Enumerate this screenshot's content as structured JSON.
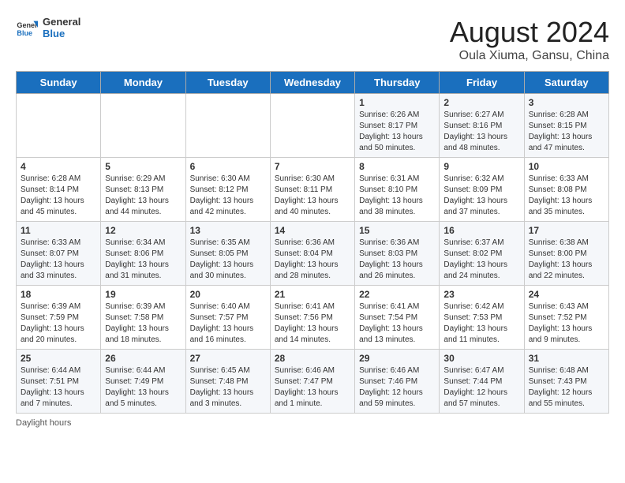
{
  "header": {
    "logo_line1": "General",
    "logo_line2": "Blue",
    "title": "August 2024",
    "subtitle": "Oula Xiuma, Gansu, China"
  },
  "weekdays": [
    "Sunday",
    "Monday",
    "Tuesday",
    "Wednesday",
    "Thursday",
    "Friday",
    "Saturday"
  ],
  "weeks": [
    [
      {
        "day": "",
        "info": ""
      },
      {
        "day": "",
        "info": ""
      },
      {
        "day": "",
        "info": ""
      },
      {
        "day": "",
        "info": ""
      },
      {
        "day": "1",
        "info": "Sunrise: 6:26 AM\nSunset: 8:17 PM\nDaylight: 13 hours\nand 50 minutes."
      },
      {
        "day": "2",
        "info": "Sunrise: 6:27 AM\nSunset: 8:16 PM\nDaylight: 13 hours\nand 48 minutes."
      },
      {
        "day": "3",
        "info": "Sunrise: 6:28 AM\nSunset: 8:15 PM\nDaylight: 13 hours\nand 47 minutes."
      }
    ],
    [
      {
        "day": "4",
        "info": "Sunrise: 6:28 AM\nSunset: 8:14 PM\nDaylight: 13 hours\nand 45 minutes."
      },
      {
        "day": "5",
        "info": "Sunrise: 6:29 AM\nSunset: 8:13 PM\nDaylight: 13 hours\nand 44 minutes."
      },
      {
        "day": "6",
        "info": "Sunrise: 6:30 AM\nSunset: 8:12 PM\nDaylight: 13 hours\nand 42 minutes."
      },
      {
        "day": "7",
        "info": "Sunrise: 6:30 AM\nSunset: 8:11 PM\nDaylight: 13 hours\nand 40 minutes."
      },
      {
        "day": "8",
        "info": "Sunrise: 6:31 AM\nSunset: 8:10 PM\nDaylight: 13 hours\nand 38 minutes."
      },
      {
        "day": "9",
        "info": "Sunrise: 6:32 AM\nSunset: 8:09 PM\nDaylight: 13 hours\nand 37 minutes."
      },
      {
        "day": "10",
        "info": "Sunrise: 6:33 AM\nSunset: 8:08 PM\nDaylight: 13 hours\nand 35 minutes."
      }
    ],
    [
      {
        "day": "11",
        "info": "Sunrise: 6:33 AM\nSunset: 8:07 PM\nDaylight: 13 hours\nand 33 minutes."
      },
      {
        "day": "12",
        "info": "Sunrise: 6:34 AM\nSunset: 8:06 PM\nDaylight: 13 hours\nand 31 minutes."
      },
      {
        "day": "13",
        "info": "Sunrise: 6:35 AM\nSunset: 8:05 PM\nDaylight: 13 hours\nand 30 minutes."
      },
      {
        "day": "14",
        "info": "Sunrise: 6:36 AM\nSunset: 8:04 PM\nDaylight: 13 hours\nand 28 minutes."
      },
      {
        "day": "15",
        "info": "Sunrise: 6:36 AM\nSunset: 8:03 PM\nDaylight: 13 hours\nand 26 minutes."
      },
      {
        "day": "16",
        "info": "Sunrise: 6:37 AM\nSunset: 8:02 PM\nDaylight: 13 hours\nand 24 minutes."
      },
      {
        "day": "17",
        "info": "Sunrise: 6:38 AM\nSunset: 8:00 PM\nDaylight: 13 hours\nand 22 minutes."
      }
    ],
    [
      {
        "day": "18",
        "info": "Sunrise: 6:39 AM\nSunset: 7:59 PM\nDaylight: 13 hours\nand 20 minutes."
      },
      {
        "day": "19",
        "info": "Sunrise: 6:39 AM\nSunset: 7:58 PM\nDaylight: 13 hours\nand 18 minutes."
      },
      {
        "day": "20",
        "info": "Sunrise: 6:40 AM\nSunset: 7:57 PM\nDaylight: 13 hours\nand 16 minutes."
      },
      {
        "day": "21",
        "info": "Sunrise: 6:41 AM\nSunset: 7:56 PM\nDaylight: 13 hours\nand 14 minutes."
      },
      {
        "day": "22",
        "info": "Sunrise: 6:41 AM\nSunset: 7:54 PM\nDaylight: 13 hours\nand 13 minutes."
      },
      {
        "day": "23",
        "info": "Sunrise: 6:42 AM\nSunset: 7:53 PM\nDaylight: 13 hours\nand 11 minutes."
      },
      {
        "day": "24",
        "info": "Sunrise: 6:43 AM\nSunset: 7:52 PM\nDaylight: 13 hours\nand 9 minutes."
      }
    ],
    [
      {
        "day": "25",
        "info": "Sunrise: 6:44 AM\nSunset: 7:51 PM\nDaylight: 13 hours\nand 7 minutes."
      },
      {
        "day": "26",
        "info": "Sunrise: 6:44 AM\nSunset: 7:49 PM\nDaylight: 13 hours\nand 5 minutes."
      },
      {
        "day": "27",
        "info": "Sunrise: 6:45 AM\nSunset: 7:48 PM\nDaylight: 13 hours\nand 3 minutes."
      },
      {
        "day": "28",
        "info": "Sunrise: 6:46 AM\nSunset: 7:47 PM\nDaylight: 13 hours\nand 1 minute."
      },
      {
        "day": "29",
        "info": "Sunrise: 6:46 AM\nSunset: 7:46 PM\nDaylight: 12 hours\nand 59 minutes."
      },
      {
        "day": "30",
        "info": "Sunrise: 6:47 AM\nSunset: 7:44 PM\nDaylight: 12 hours\nand 57 minutes."
      },
      {
        "day": "31",
        "info": "Sunrise: 6:48 AM\nSunset: 7:43 PM\nDaylight: 12 hours\nand 55 minutes."
      }
    ]
  ],
  "footer": {
    "daylight_label": "Daylight hours"
  }
}
